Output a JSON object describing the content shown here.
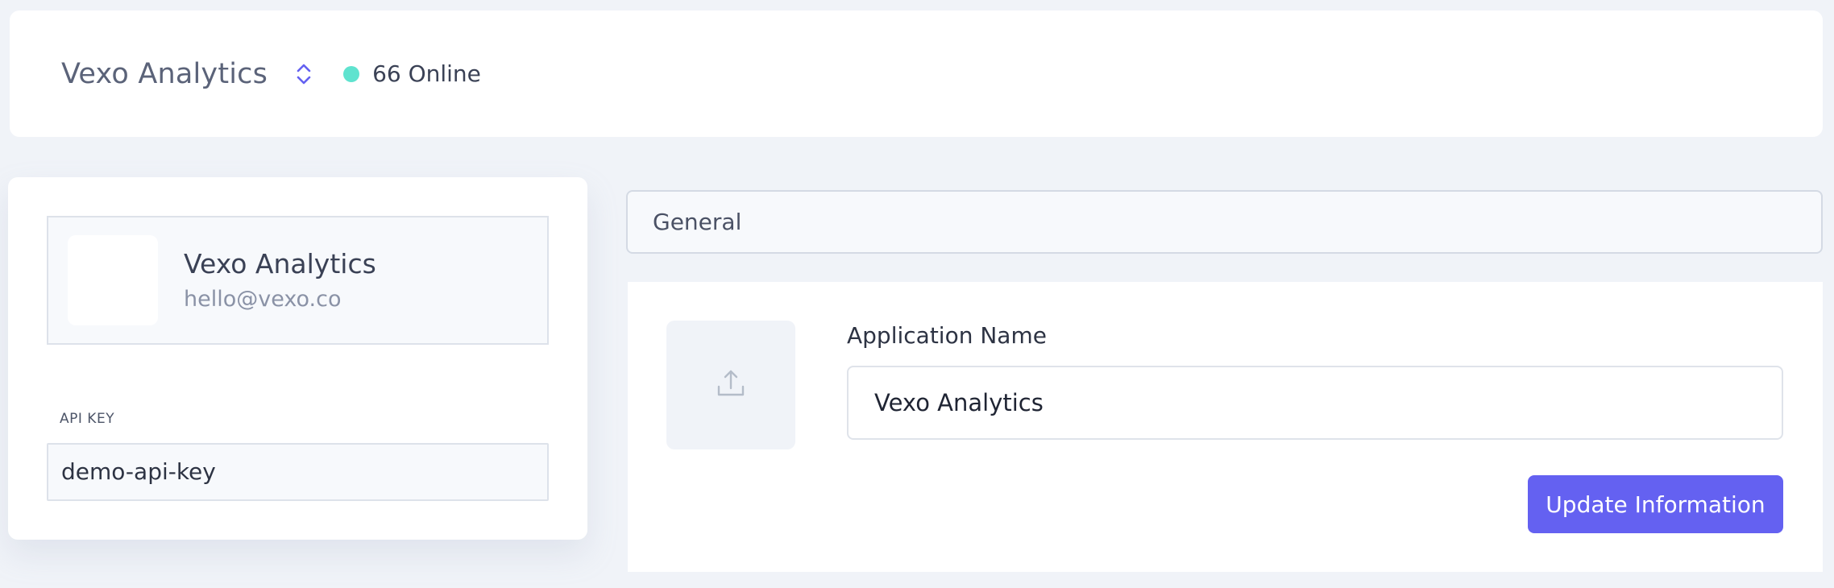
{
  "header": {
    "app_title": "Vexo Analytics",
    "online_count_label": "66 Online",
    "online_dot_color": "#5fe3cf",
    "switcher_icon": "chevron-up-down-icon"
  },
  "profile": {
    "name": "Vexo Analytics",
    "email": "hello@vexo.co"
  },
  "api": {
    "label": "API KEY",
    "value": "demo-api-key"
  },
  "tabs": {
    "general_label": "General"
  },
  "form": {
    "upload_icon": "upload-icon",
    "app_name_label": "Application Name",
    "app_name_value": "Vexo Analytics",
    "update_button_label": "Update Information"
  },
  "colors": {
    "accent": "#6461f1",
    "background": "#f0f3f8"
  }
}
